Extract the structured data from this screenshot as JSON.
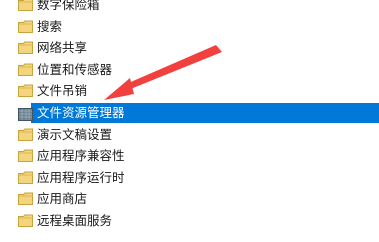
{
  "tree": {
    "items": [
      {
        "label": "数字保险箱",
        "icon": "folder-icon"
      },
      {
        "label": "搜索",
        "icon": "folder-icon"
      },
      {
        "label": "网络共享",
        "icon": "folder-icon"
      },
      {
        "label": "位置和传感器",
        "icon": "folder-icon"
      },
      {
        "label": "文件吊销",
        "icon": "folder-icon"
      },
      {
        "label": "文件资源管理器",
        "icon": "policy-folder-icon",
        "selected": true
      },
      {
        "label": "演示文稿设置",
        "icon": "folder-icon"
      },
      {
        "label": "应用程序兼容性",
        "icon": "folder-icon"
      },
      {
        "label": "应用程序运行时",
        "icon": "folder-icon"
      },
      {
        "label": "应用商店",
        "icon": "folder-icon"
      },
      {
        "label": "远程桌面服务",
        "icon": "folder-icon"
      }
    ]
  },
  "colors": {
    "selection": "#0078d7",
    "arrow": "#f0413f",
    "folder": "#e8c25a"
  }
}
